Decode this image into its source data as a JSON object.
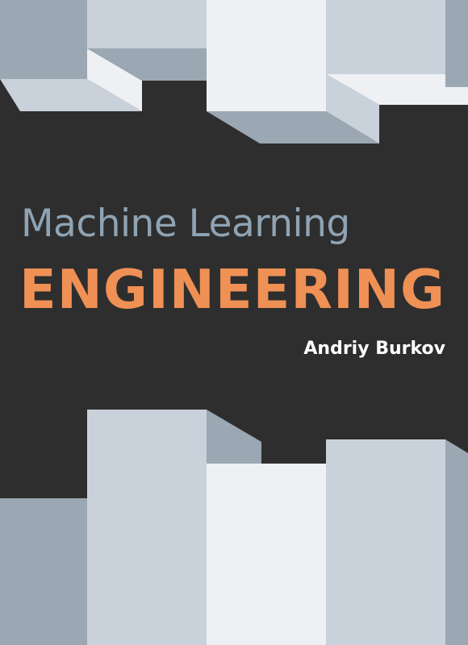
{
  "cover": {
    "title_line1": "Machine Learning",
    "title_line2": "ENGINEERING",
    "author": "Andriy Burkov"
  },
  "colors": {
    "background": "#2e2e2e",
    "title_line1": "#8fa3b3",
    "title_line2": "#ef9055",
    "author": "#ffffff",
    "block_light": "#eef0f3",
    "block_mid": "#c9d1da",
    "block_dark": "#9ba7b2"
  }
}
